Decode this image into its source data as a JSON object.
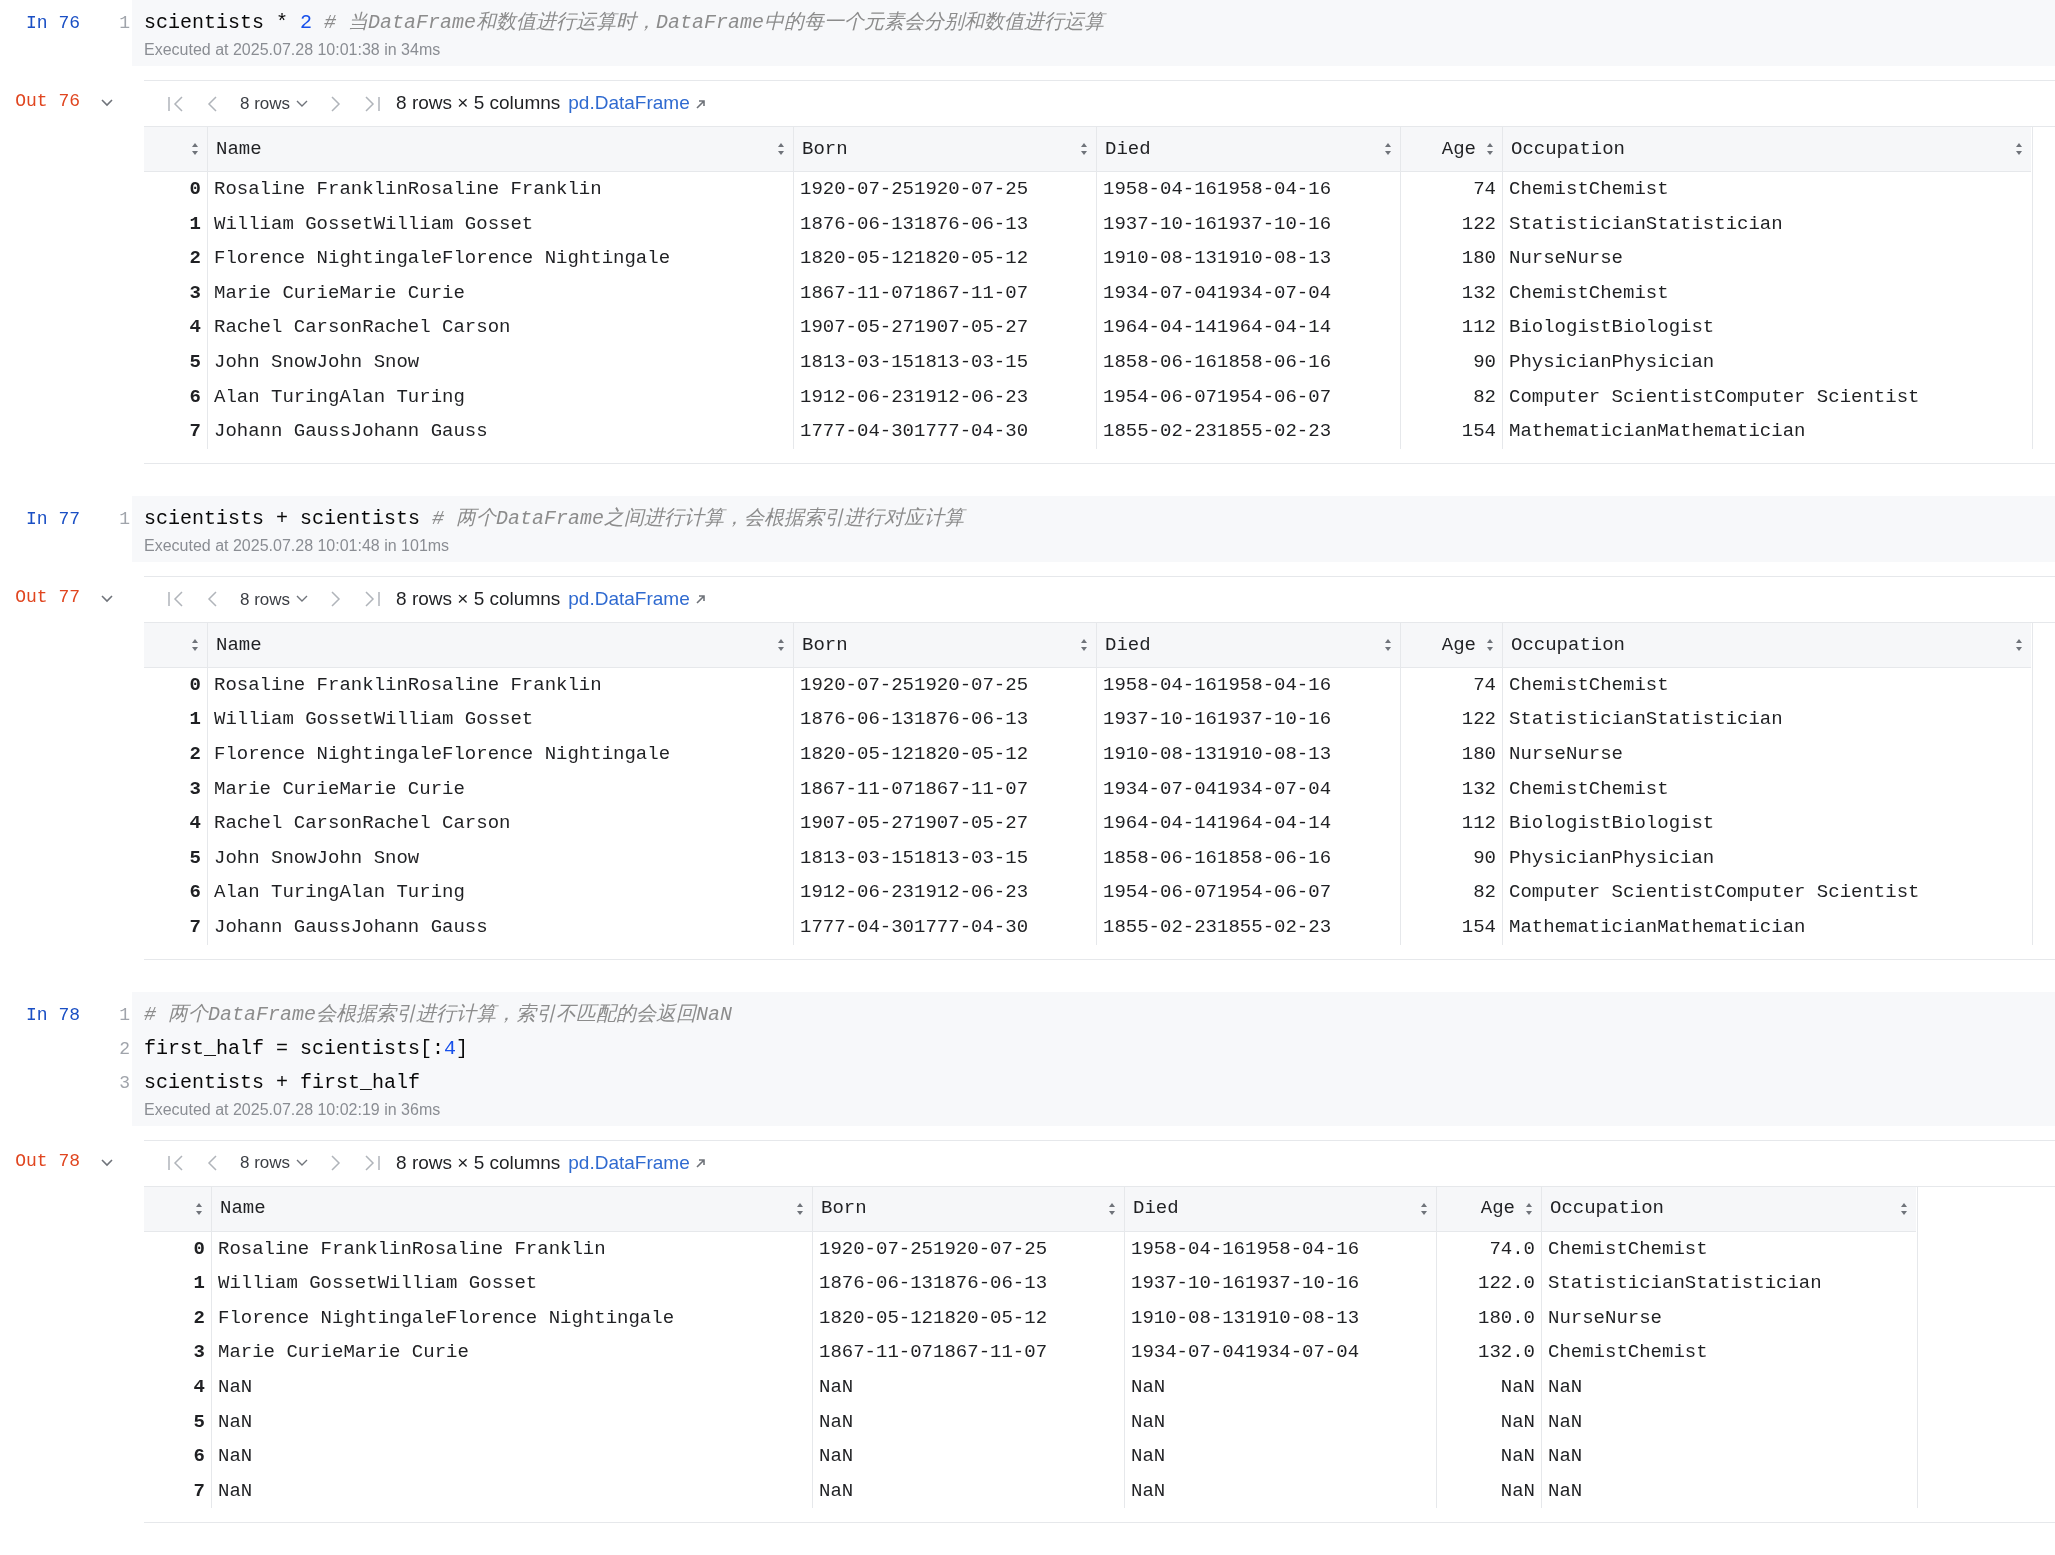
{
  "cells": [
    {
      "in_label": "In 76",
      "lines": [
        {
          "number": "1",
          "tokens": [
            {
              "kind": "code",
              "text": "scientists * "
            },
            {
              "kind": "number",
              "text": "2"
            },
            {
              "kind": "comment",
              "text": " # 当DataFrame和数值进行运算时，DataFrame中的每一个元素会分别和数值进行运算"
            }
          ]
        }
      ],
      "executed": "Executed at 2025.07.28 10:01:38 in 34ms",
      "out_label": "Out 76",
      "toolbar": {
        "page_size": "8 rows",
        "summary": "8 rows × 5 columns",
        "type_link": "pd.DataFrame"
      },
      "table": {
        "columns": [
          {
            "label": "Name",
            "numeric": false
          },
          {
            "label": "Born",
            "numeric": false
          },
          {
            "label": "Died",
            "numeric": false
          },
          {
            "label": "Age",
            "numeric": true
          },
          {
            "label": "Occupation",
            "numeric": false
          }
        ],
        "rows": [
          {
            "index": "0",
            "cells": [
              "Rosaline FranklinRosaline Franklin",
              "1920-07-251920-07-25",
              "1958-04-161958-04-16",
              "74",
              "ChemistChemist"
            ]
          },
          {
            "index": "1",
            "cells": [
              "William GossetWilliam Gosset",
              "1876-06-131876-06-13",
              "1937-10-161937-10-16",
              "122",
              "StatisticianStatistician"
            ]
          },
          {
            "index": "2",
            "cells": [
              "Florence NightingaleFlorence Nightingale",
              "1820-05-121820-05-12",
              "1910-08-131910-08-13",
              "180",
              "NurseNurse"
            ]
          },
          {
            "index": "3",
            "cells": [
              "Marie CurieMarie Curie",
              "1867-11-071867-11-07",
              "1934-07-041934-07-04",
              "132",
              "ChemistChemist"
            ]
          },
          {
            "index": "4",
            "cells": [
              "Rachel CarsonRachel Carson",
              "1907-05-271907-05-27",
              "1964-04-141964-04-14",
              "112",
              "BiologistBiologist"
            ]
          },
          {
            "index": "5",
            "cells": [
              "John SnowJohn Snow",
              "1813-03-151813-03-15",
              "1858-06-161858-06-16",
              "90",
              "PhysicianPhysician"
            ]
          },
          {
            "index": "6",
            "cells": [
              "Alan TuringAlan Turing",
              "1912-06-231912-06-23",
              "1954-06-071954-06-07",
              "82",
              "Computer ScientistComputer Scientist"
            ]
          },
          {
            "index": "7",
            "cells": [
              "Johann GaussJohann Gauss",
              "1777-04-301777-04-30",
              "1855-02-231855-02-23",
              "154",
              "MathematicianMathematician"
            ]
          }
        ]
      }
    },
    {
      "in_label": "In 77",
      "lines": [
        {
          "number": "1",
          "tokens": [
            {
              "kind": "code",
              "text": "scientists + scientists"
            },
            {
              "kind": "comment",
              "text": " # 两个DataFrame之间进行计算，会根据索引进行对应计算"
            }
          ]
        }
      ],
      "executed": "Executed at 2025.07.28 10:01:48 in 101ms",
      "out_label": "Out 77",
      "toolbar": {
        "page_size": "8 rows",
        "summary": "8 rows × 5 columns",
        "type_link": "pd.DataFrame"
      },
      "table": {
        "columns": [
          {
            "label": "Name",
            "numeric": false
          },
          {
            "label": "Born",
            "numeric": false
          },
          {
            "label": "Died",
            "numeric": false
          },
          {
            "label": "Age",
            "numeric": true
          },
          {
            "label": "Occupation",
            "numeric": false
          }
        ],
        "rows": [
          {
            "index": "0",
            "cells": [
              "Rosaline FranklinRosaline Franklin",
              "1920-07-251920-07-25",
              "1958-04-161958-04-16",
              "74",
              "ChemistChemist"
            ]
          },
          {
            "index": "1",
            "cells": [
              "William GossetWilliam Gosset",
              "1876-06-131876-06-13",
              "1937-10-161937-10-16",
              "122",
              "StatisticianStatistician"
            ]
          },
          {
            "index": "2",
            "cells": [
              "Florence NightingaleFlorence Nightingale",
              "1820-05-121820-05-12",
              "1910-08-131910-08-13",
              "180",
              "NurseNurse"
            ]
          },
          {
            "index": "3",
            "cells": [
              "Marie CurieMarie Curie",
              "1867-11-071867-11-07",
              "1934-07-041934-07-04",
              "132",
              "ChemistChemist"
            ]
          },
          {
            "index": "4",
            "cells": [
              "Rachel CarsonRachel Carson",
              "1907-05-271907-05-27",
              "1964-04-141964-04-14",
              "112",
              "BiologistBiologist"
            ]
          },
          {
            "index": "5",
            "cells": [
              "John SnowJohn Snow",
              "1813-03-151813-03-15",
              "1858-06-161858-06-16",
              "90",
              "PhysicianPhysician"
            ]
          },
          {
            "index": "6",
            "cells": [
              "Alan TuringAlan Turing",
              "1912-06-231912-06-23",
              "1954-06-071954-06-07",
              "82",
              "Computer ScientistComputer Scientist"
            ]
          },
          {
            "index": "7",
            "cells": [
              "Johann GaussJohann Gauss",
              "1777-04-301777-04-30",
              "1855-02-231855-02-23",
              "154",
              "MathematicianMathematician"
            ]
          }
        ]
      }
    },
    {
      "in_label": "In 78",
      "lines": [
        {
          "number": "1",
          "tokens": [
            {
              "kind": "comment",
              "text": "# 两个DataFrame会根据索引进行计算，索引不匹配的会返回NaN"
            }
          ]
        },
        {
          "number": "2",
          "tokens": [
            {
              "kind": "code",
              "text": "first_half = scientists[:"
            },
            {
              "kind": "number",
              "text": "4"
            },
            {
              "kind": "code",
              "text": "]"
            }
          ]
        },
        {
          "number": "3",
          "tokens": [
            {
              "kind": "code",
              "text": "scientists + first_half"
            }
          ]
        }
      ],
      "executed": "Executed at 2025.07.28 10:02:19 in 36ms",
      "out_label": "Out 78",
      "toolbar": {
        "page_size": "8 rows",
        "summary": "8 rows × 5 columns",
        "type_link": "pd.DataFrame"
      },
      "table": {
        "columns": [
          {
            "label": "Name",
            "numeric": false
          },
          {
            "label": "Born",
            "numeric": false
          },
          {
            "label": "Died",
            "numeric": false
          },
          {
            "label": "Age",
            "numeric": true
          },
          {
            "label": "Occupation",
            "numeric": false
          }
        ],
        "rows": [
          {
            "index": "0",
            "cells": [
              "Rosaline FranklinRosaline Franklin",
              "1920-07-251920-07-25",
              "1958-04-161958-04-16",
              "74.0",
              "ChemistChemist"
            ]
          },
          {
            "index": "1",
            "cells": [
              "William GossetWilliam Gosset",
              "1876-06-131876-06-13",
              "1937-10-161937-10-16",
              "122.0",
              "StatisticianStatistician"
            ]
          },
          {
            "index": "2",
            "cells": [
              "Florence NightingaleFlorence Nightingale",
              "1820-05-121820-05-12",
              "1910-08-131910-08-13",
              "180.0",
              "NurseNurse"
            ]
          },
          {
            "index": "3",
            "cells": [
              "Marie CurieMarie Curie",
              "1867-11-071867-11-07",
              "1934-07-041934-07-04",
              "132.0",
              "ChemistChemist"
            ]
          },
          {
            "index": "4",
            "cells": [
              "NaN",
              "NaN",
              "NaN",
              "NaN",
              "NaN"
            ]
          },
          {
            "index": "5",
            "cells": [
              "NaN",
              "NaN",
              "NaN",
              "NaN",
              "NaN"
            ]
          },
          {
            "index": "6",
            "cells": [
              "NaN",
              "NaN",
              "NaN",
              "NaN",
              "NaN"
            ]
          },
          {
            "index": "7",
            "cells": [
              "NaN",
              "NaN",
              "NaN",
              "NaN",
              "NaN"
            ]
          }
        ]
      }
    }
  ]
}
